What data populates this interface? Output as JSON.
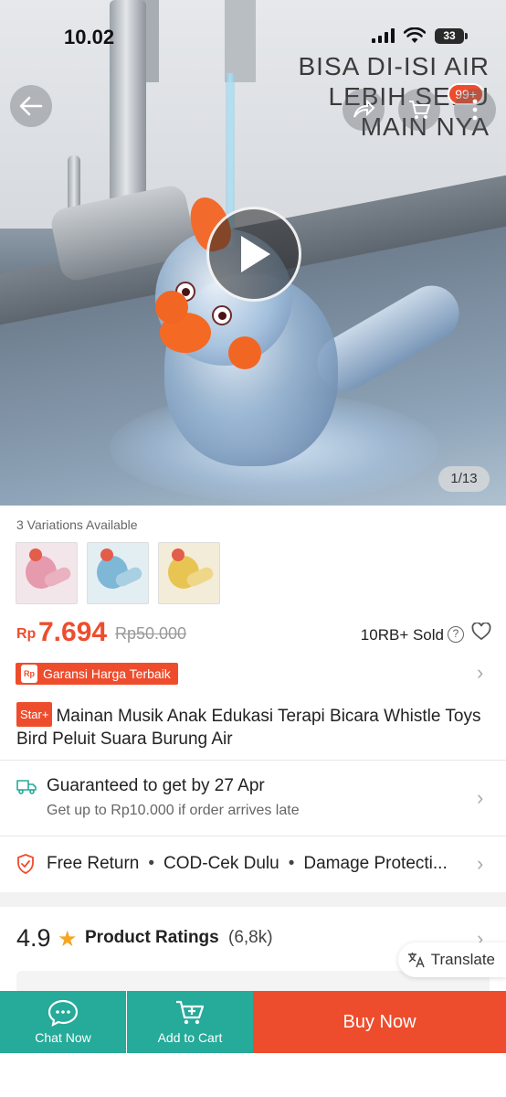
{
  "status_bar": {
    "time": "10.02",
    "battery": "33"
  },
  "hero": {
    "promo_text": [
      "BISA DI-ISI AIR",
      "LEBIH SERU",
      "MAIN NYA"
    ],
    "cart_badge": "99+",
    "image_counter": "1/13"
  },
  "variations": {
    "label": "3 Variations Available",
    "count": 3
  },
  "price": {
    "currency": "Rp",
    "current": "7.694",
    "original": "Rp50.000",
    "sold": "10RB+ Sold"
  },
  "guarantee": {
    "label": "Garansi Harga Terbaik",
    "icon_text": "Rp"
  },
  "product": {
    "badge": "Star+",
    "title": "Mainan Musik Anak Edukasi Terapi Bicara Whistle Toys Bird Peluit Suara Burung Air"
  },
  "shipping": {
    "main": "Guaranteed to get by 27 Apr",
    "sub": "Get up to Rp10.000 if order arrives late"
  },
  "services": {
    "items": [
      "Free Return",
      "COD-Cek Dulu",
      "Damage Protecti..."
    ]
  },
  "ratings": {
    "score": "4.9",
    "label": "Product Ratings",
    "count": "(6,8k)",
    "translate": "Translate"
  },
  "bottom_bar": {
    "chat": "Chat Now",
    "cart": "Add to Cart",
    "buy": "Buy Now"
  },
  "colors": {
    "accent": "#ee4d2d",
    "teal": "#26aa99",
    "star": "#f5a623"
  },
  "icons": [
    "back-arrow-icon",
    "share-icon",
    "cart-icon",
    "more-icon",
    "play-icon",
    "help-icon",
    "heart-icon",
    "truck-icon",
    "shield-icon",
    "translate-icon",
    "chat-icon",
    "add-cart-icon",
    "chevron-right-icon"
  ]
}
